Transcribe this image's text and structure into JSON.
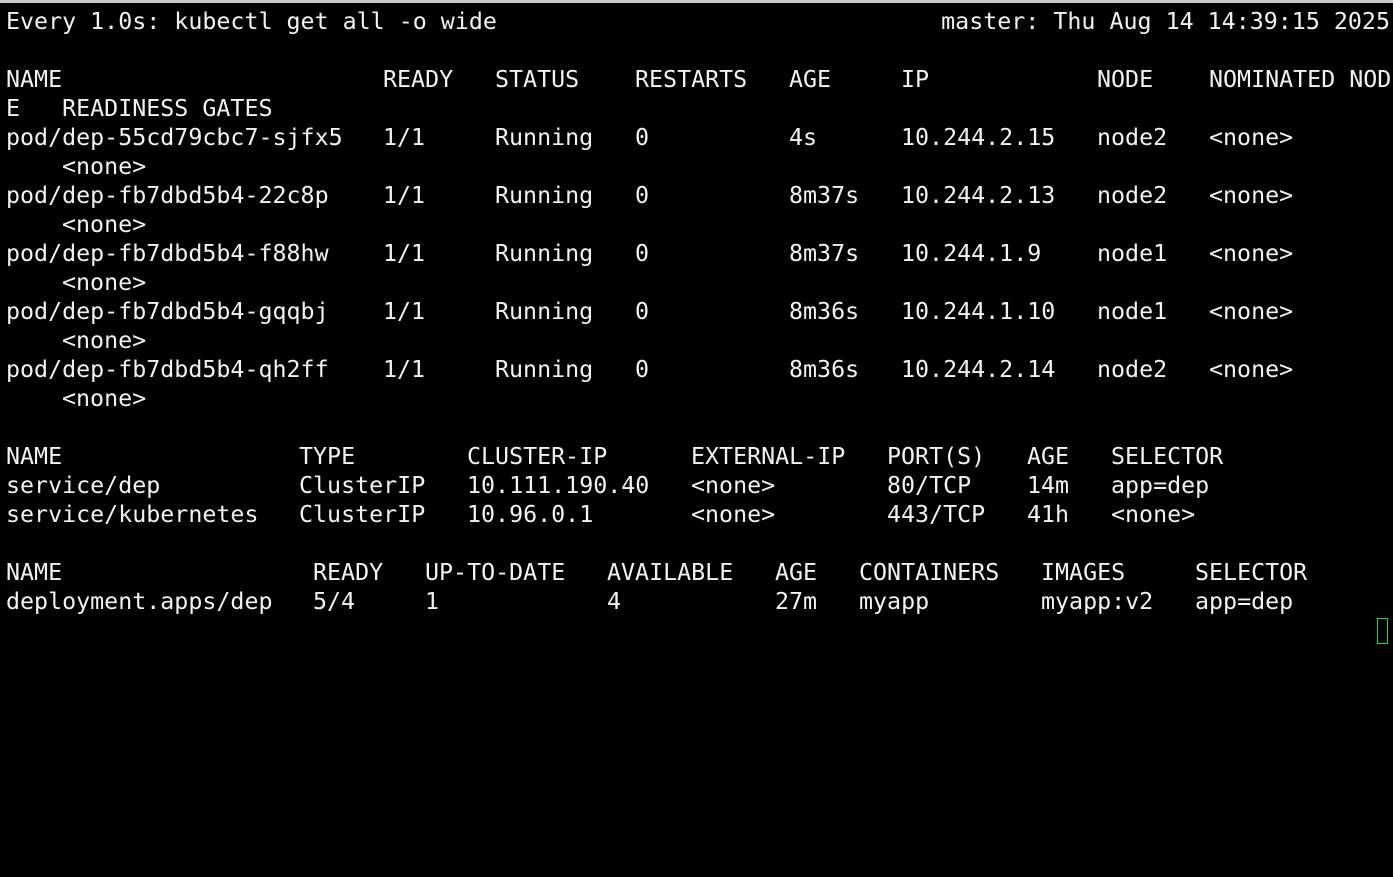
{
  "colors": {
    "background": "#000000",
    "foreground": "#f2f2f2",
    "cursor": "#1fd14a"
  },
  "header": {
    "command": "Every 1.0s: kubectl get all -o wide",
    "host_time": "master: Thu Aug 14 14:39:15 2025"
  },
  "pods": {
    "headers": [
      "NAME",
      "READY",
      "STATUS",
      "RESTARTS",
      "AGE",
      "IP",
      "NODE",
      "NOMINATED NOD"
    ],
    "header_wrap": "E   READINESS GATES",
    "rows": [
      {
        "name": "pod/dep-55cd79cbc7-sjfx5",
        "ready": "1/1",
        "status": "Running",
        "restarts": "0",
        "age": "4s",
        "ip": "10.244.2.15",
        "node": "node2",
        "nominated": "<none>",
        "readiness": "<none>"
      },
      {
        "name": "pod/dep-fb7dbd5b4-22c8p",
        "ready": "1/1",
        "status": "Running",
        "restarts": "0",
        "age": "8m37s",
        "ip": "10.244.2.13",
        "node": "node2",
        "nominated": "<none>",
        "readiness": "<none>"
      },
      {
        "name": "pod/dep-fb7dbd5b4-f88hw",
        "ready": "1/1",
        "status": "Running",
        "restarts": "0",
        "age": "8m37s",
        "ip": "10.244.1.9",
        "node": "node1",
        "nominated": "<none>",
        "readiness": "<none>"
      },
      {
        "name": "pod/dep-fb7dbd5b4-gqqbj",
        "ready": "1/1",
        "status": "Running",
        "restarts": "0",
        "age": "8m36s",
        "ip": "10.244.1.10",
        "node": "node1",
        "nominated": "<none>",
        "readiness": "<none>"
      },
      {
        "name": "pod/dep-fb7dbd5b4-qh2ff",
        "ready": "1/1",
        "status": "Running",
        "restarts": "0",
        "age": "8m36s",
        "ip": "10.244.2.14",
        "node": "node2",
        "nominated": "<none>",
        "readiness": "<none>"
      }
    ]
  },
  "services": {
    "headers": [
      "NAME",
      "TYPE",
      "CLUSTER-IP",
      "EXTERNAL-IP",
      "PORT(S)",
      "AGE",
      "SELECTOR"
    ],
    "rows": [
      {
        "name": "service/dep",
        "type": "ClusterIP",
        "cluster_ip": "10.111.190.40",
        "external_ip": "<none>",
        "ports": "80/TCP",
        "age": "14m",
        "selector": "app=dep"
      },
      {
        "name": "service/kubernetes",
        "type": "ClusterIP",
        "cluster_ip": "10.96.0.1",
        "external_ip": "<none>",
        "ports": "443/TCP",
        "age": "41h",
        "selector": "<none>"
      }
    ]
  },
  "deployments": {
    "headers": [
      "NAME",
      "READY",
      "UP-TO-DATE",
      "AVAILABLE",
      "AGE",
      "CONTAINERS",
      "IMAGES",
      "SELECTOR"
    ],
    "rows": [
      {
        "name": "deployment.apps/dep",
        "ready": "5/4",
        "up_to_date": "1",
        "available": "4",
        "age": "27m",
        "containers": "myapp",
        "images": "myapp:v2",
        "selector": "app=dep"
      }
    ]
  }
}
